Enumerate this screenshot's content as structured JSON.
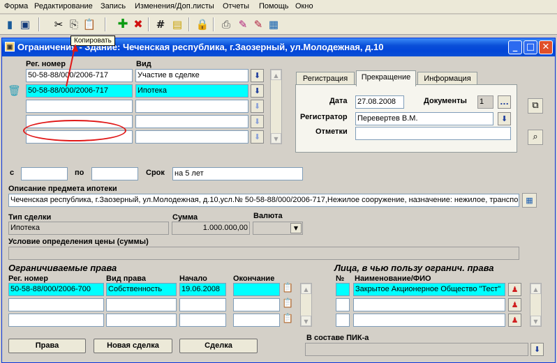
{
  "menu": [
    "Форма",
    "Редактирование",
    "Запись",
    "Изменения/Доп.листы",
    "Отчеты",
    "Помощь",
    "Окно"
  ],
  "tooltip": "Копировать",
  "window": {
    "title": "Ограничения - Здание: Чеченская республика, г.Заозерный, ул.Молодежная, д.10",
    "minimize": "_",
    "maximize": "□",
    "close": "✕"
  },
  "reg": {
    "header_number": "Рег. номер",
    "header_kind": "Вид",
    "rows": [
      {
        "number": "50-58-88/000/2006-717",
        "kind": "Участие в сделке"
      },
      {
        "number": "50-58-88/000/2006-717",
        "kind": "Ипотека"
      },
      {
        "number": "",
        "kind": ""
      },
      {
        "number": "",
        "kind": ""
      },
      {
        "number": "",
        "kind": ""
      }
    ]
  },
  "tabs": [
    "Регистрация",
    "Прекращение",
    "Информация"
  ],
  "termination": {
    "date_label": "Дата",
    "date_value": "27.08.2008",
    "docs_label": "Документы",
    "docs_value": "1",
    "docs_btn": "...",
    "registrar_label": "Регистратор",
    "registrar_value": "Перевертев В.М.",
    "notes_label": "Отметки",
    "notes_value": ""
  },
  "period": {
    "from_label": "с",
    "to_label": "по",
    "term_label": "Срок",
    "from": "",
    "to": "",
    "term": "на 5 лет"
  },
  "mortgage": {
    "subject_label": "Описание предмета ипотеки",
    "subject_value": "Чеченская республика, г.Заозерный, ул.Молодежная, д.10,усл.№ 50-58-88/000/2006-717,Нежилое сооружение, назначение: нежилое, транспортное"
  },
  "deal": {
    "type_label": "Тип сделки",
    "type_value": "Ипотека",
    "sum_label": "Сумма",
    "sum_value": "1.000.000,00",
    "currency_label": "Валюта",
    "currency_value": "",
    "price_cond_label": "Условие определения цены (суммы)",
    "price_cond_value": ""
  },
  "limited_rights": {
    "title": "Ограничиваемые права",
    "headers": [
      "Рег. номер",
      "Вид права",
      "Начало",
      "Окончание"
    ],
    "rows": [
      [
        "50-58-88/000/2006-700",
        "Собственность",
        "19.06.2008",
        ""
      ],
      [
        "",
        "",
        "",
        ""
      ],
      [
        "",
        "",
        "",
        ""
      ]
    ]
  },
  "beneficiaries": {
    "title": "Лица, в чью пользу огранич. права",
    "header_no": "№",
    "header_name": "Наименование/ФИО",
    "rows": [
      {
        "no": "",
        "name": "Закрытое Акционерное Общество \"Тест\""
      },
      {
        "no": "",
        "name": ""
      },
      {
        "no": "",
        "name": ""
      }
    ]
  },
  "buttons": {
    "rights": "Права",
    "new_deal": "Новая сделка",
    "deal": "Сделка"
  },
  "pik": {
    "label": "В составе ПИК-а",
    "value": ""
  },
  "colors": {
    "highlight": "#00ffff",
    "titlebar": "#0a4fd8",
    "annotation": "#e01818"
  }
}
